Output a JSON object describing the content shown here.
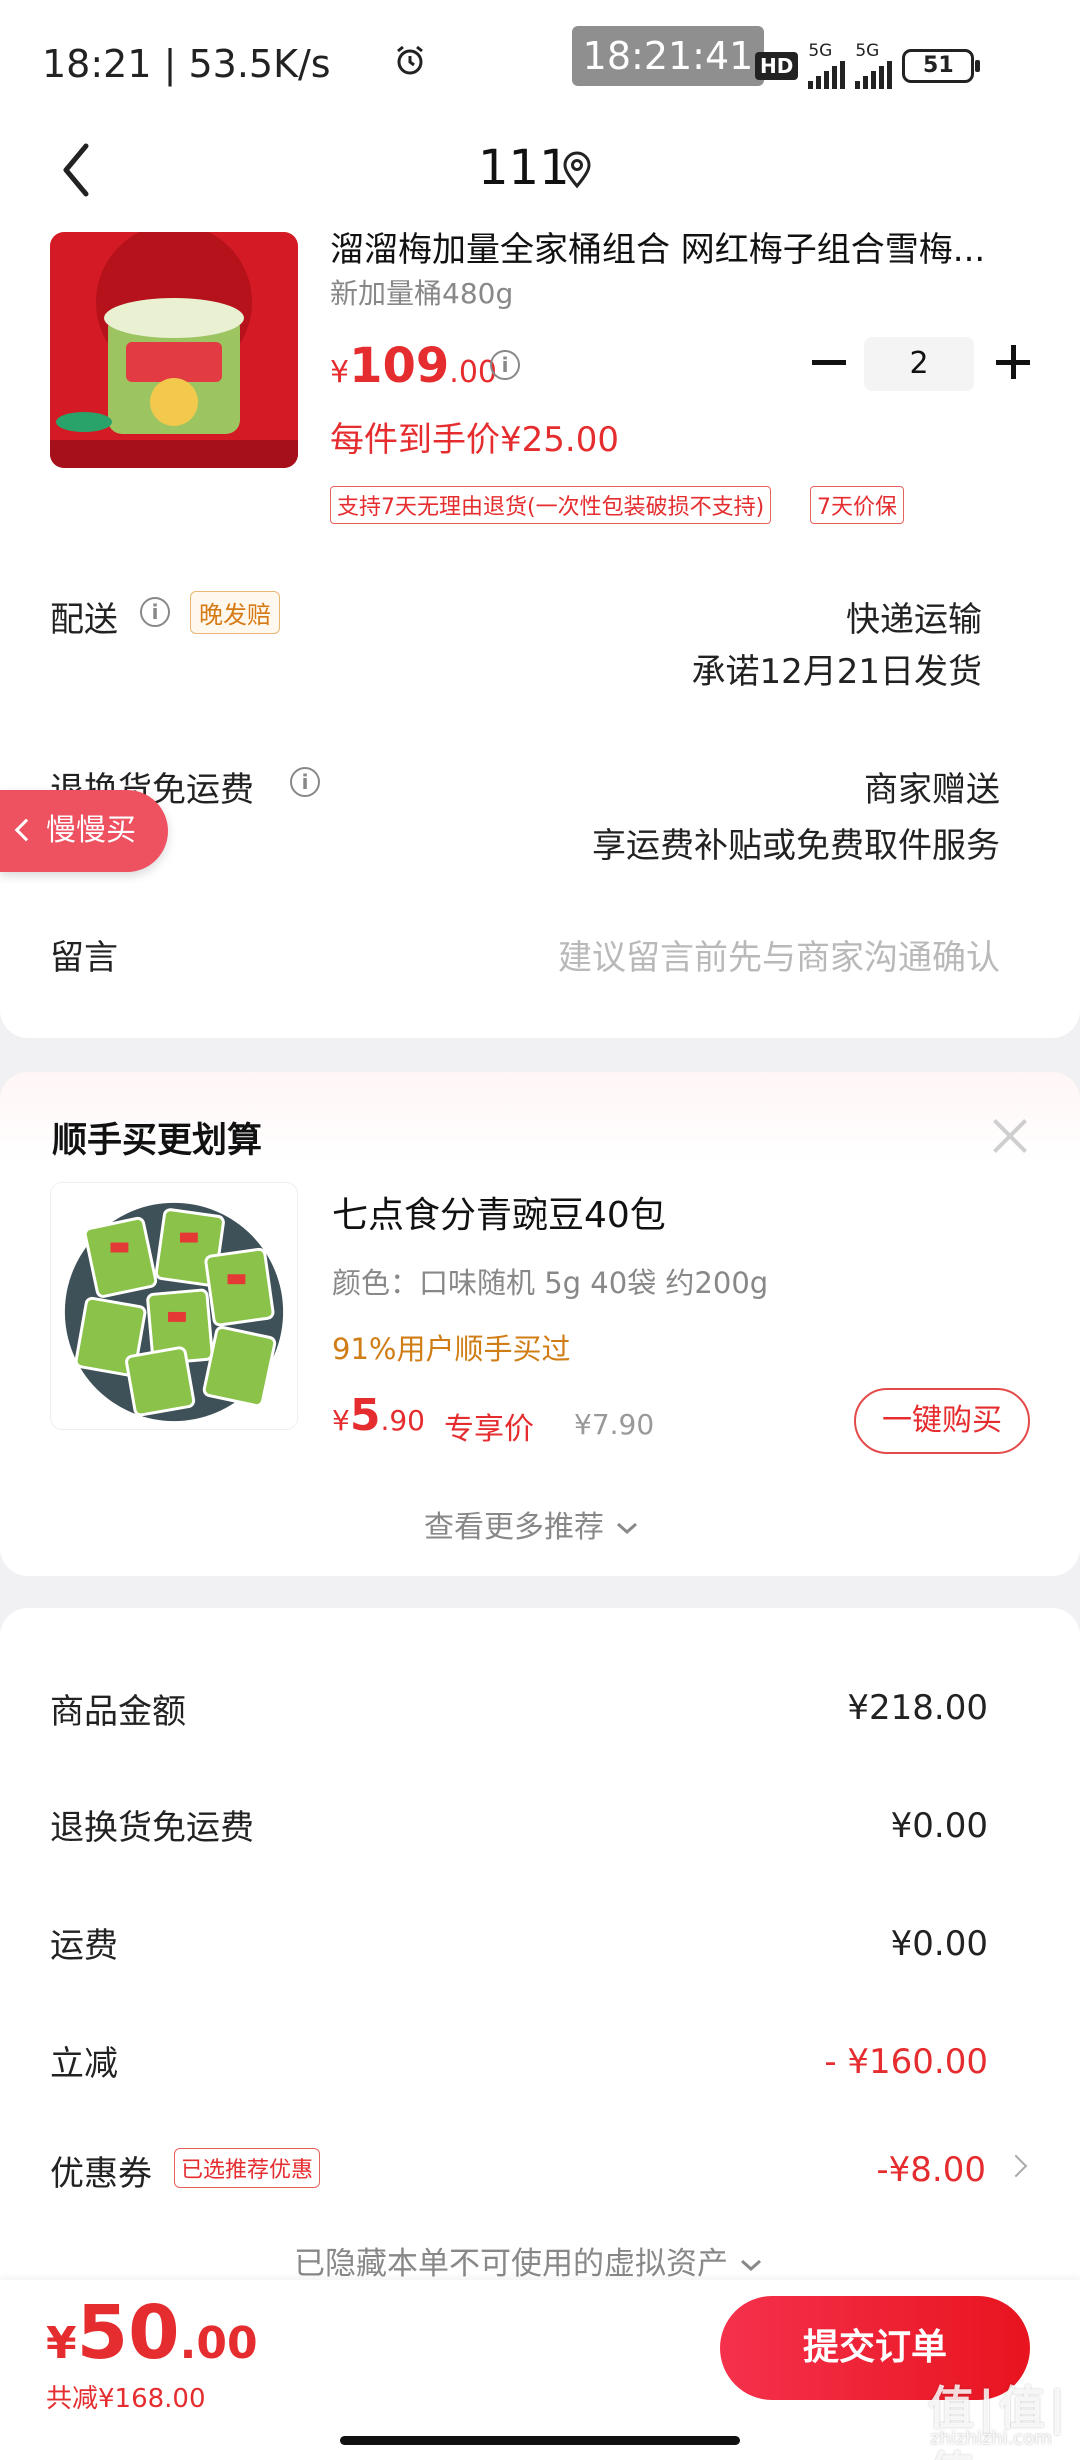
{
  "status_bar": {
    "left_text": "18:21 | 53.5K/s",
    "clock_overlay": "18:21:41",
    "hd_label": "HD",
    "net1": "5G",
    "net2": "5G",
    "battery": "51"
  },
  "header": {
    "title": "111"
  },
  "product": {
    "name": "溜溜梅加量全家桶组合 网红梅子组合雪梅...",
    "spec": "新加量桶480g",
    "price_currency": "¥",
    "price_int": "109",
    "price_dec": ".00",
    "quantity": "2",
    "per_item_price": "每件到手价¥25.00",
    "tags": [
      "支持7天无理由退货(一次性包装破损不支持)",
      "7天价保"
    ]
  },
  "delivery": {
    "label": "配送",
    "badge": "晚发赔",
    "method": "快递运输",
    "promise": "承诺12月21日发货"
  },
  "return_shipping": {
    "label": "退换货免运费",
    "value1": "商家赠送",
    "value2": "享运费补贴或免费取件服务"
  },
  "slow_buy": {
    "label": "慢慢买"
  },
  "message": {
    "label": "留言",
    "placeholder": "建议留言前先与商家沟通确认"
  },
  "addon": {
    "section_title": "顺手买更划算",
    "name": "七点食分青豌豆40包",
    "spec": "颜色：口味随机 5g 40袋 约200g",
    "bought": "91%用户顺手买过",
    "price_currency": "¥",
    "price_int": "5",
    "price_dec": ".90",
    "exclusive_label": "专享价",
    "original_price": "¥7.90",
    "buy_button": "一键购买",
    "more_link": "查看更多推荐"
  },
  "summary": {
    "rows": [
      {
        "label": "商品金额",
        "value": "¥218.00"
      },
      {
        "label": "退换货免运费",
        "value": "¥0.00"
      },
      {
        "label": "运费",
        "value": "¥0.00"
      },
      {
        "label": "立减",
        "value": "- ¥160.00"
      },
      {
        "label": "优惠券",
        "value": "-¥8.00"
      }
    ],
    "coupon_badge": "已选推荐优惠",
    "hidden_note": "已隐藏本单不可使用的虚拟资产"
  },
  "bottom": {
    "total_currency": "¥",
    "total_int": "50",
    "total_dec": ".00",
    "saved": "共减¥168.00",
    "submit": "提交订单"
  },
  "watermark": {
    "main": "值|值|值",
    "sub": "zhizhizhi.com"
  },
  "colors": {
    "accent_red": "#e52d2f",
    "slow_buy_bg": "#ee5160",
    "late_badge": "#d67a15"
  }
}
